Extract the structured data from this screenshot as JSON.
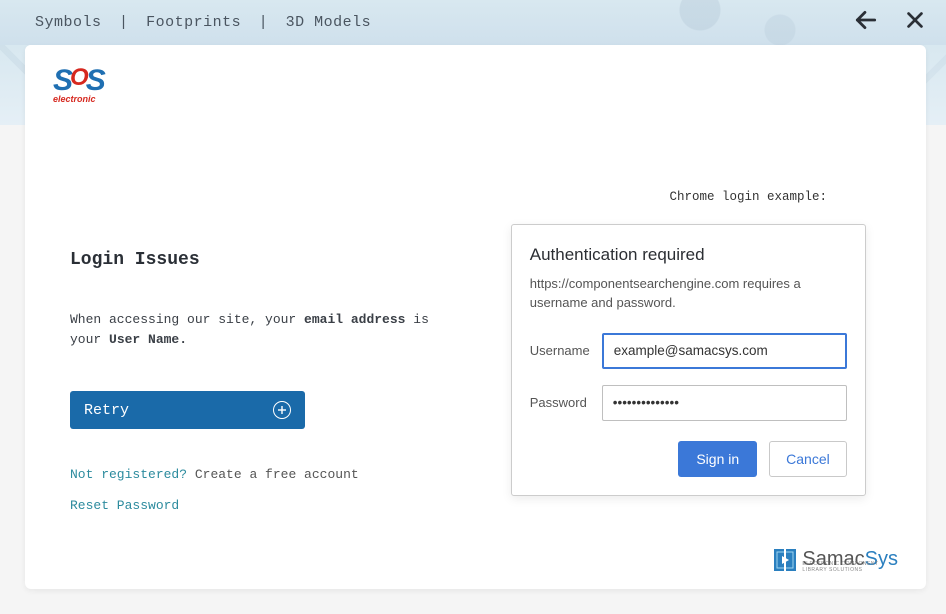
{
  "topbar": {
    "crumbs": [
      "Symbols",
      "Footprints",
      "3D Models"
    ],
    "sep": "|"
  },
  "logo": {
    "name": "SOS",
    "sub": "electronic"
  },
  "left": {
    "heading": "Login Issues",
    "sub_before": "When accessing our site, your ",
    "sub_bold1": "email address",
    "sub_mid": " is your ",
    "sub_bold2": "User Name.",
    "retry": "Retry",
    "not_registered": "Not registered?",
    "create_account": "Create a free account",
    "reset": "Reset Password"
  },
  "right": {
    "example_label": "Chrome login example:",
    "auth": {
      "title": "Authentication required",
      "desc": "https://componentsearchengine.com requires a username and password.",
      "username_label": "Username",
      "username_value": "example@samacsys.com",
      "password_label": "Password",
      "password_value": "••••••••••••••",
      "signin": "Sign in",
      "cancel": "Cancel"
    }
  },
  "footer": {
    "brand_a": "Samac",
    "brand_b": "Sys",
    "tagline": "ELECTRONIC COMPONENT LIBRARY SOLUTIONS"
  }
}
